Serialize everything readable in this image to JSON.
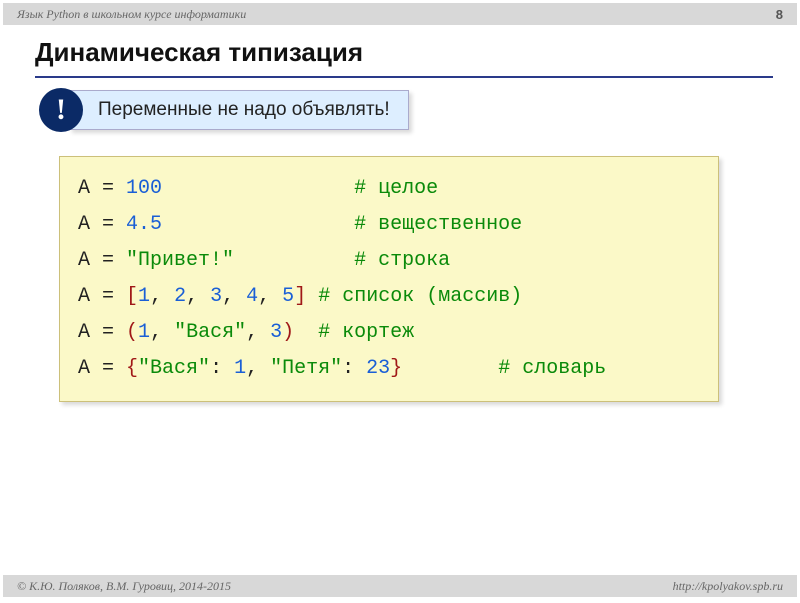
{
  "header": {
    "course": "Язык Python в школьном курсе информатики",
    "page": "8"
  },
  "title": "Динамическая типизация",
  "callout": {
    "mark": "!",
    "text": "Переменные не надо объявлять!"
  },
  "code": {
    "l1": {
      "var": "A",
      "eq": " = ",
      "val": "100",
      "pad": "                ",
      "comm": "# целое"
    },
    "l2": {
      "var": "A",
      "eq": " = ",
      "val": "4.5",
      "pad": "                ",
      "comm": "# вещественное"
    },
    "l3": {
      "var": "A",
      "eq": " = ",
      "val": "\"Привет!\"",
      "pad": "          ",
      "comm": "# строка"
    },
    "l4": {
      "var": "A",
      "eq": " = ",
      "lb": "[",
      "n1": "1",
      "c": ", ",
      "n2": "2",
      "n3": "3",
      "n4": "4",
      "n5": "5",
      "rb": "]",
      "pad": " ",
      "comm": "# список (массив)"
    },
    "l5": {
      "var": "A",
      "eq": " = ",
      "lb": "(",
      "n1": "1",
      "c": ", ",
      "s1": "\"Вася\"",
      "n2": "3",
      "rb": ")",
      "pad": "  ",
      "comm": "# кортеж"
    },
    "l6": {
      "var": "A",
      "eq": " = ",
      "lb": "{",
      "k1": "\"Вася\"",
      "colon": ": ",
      "v1": "1",
      "c": ", ",
      "k2": "\"Петя\"",
      "v2": "23",
      "rb": "}",
      "pad": "        ",
      "comm": "# словарь"
    }
  },
  "footer": {
    "copyright": "© К.Ю. Поляков, В.М. Гуровиц, 2014-2015",
    "url": "http://kpolyakov.spb.ru"
  }
}
